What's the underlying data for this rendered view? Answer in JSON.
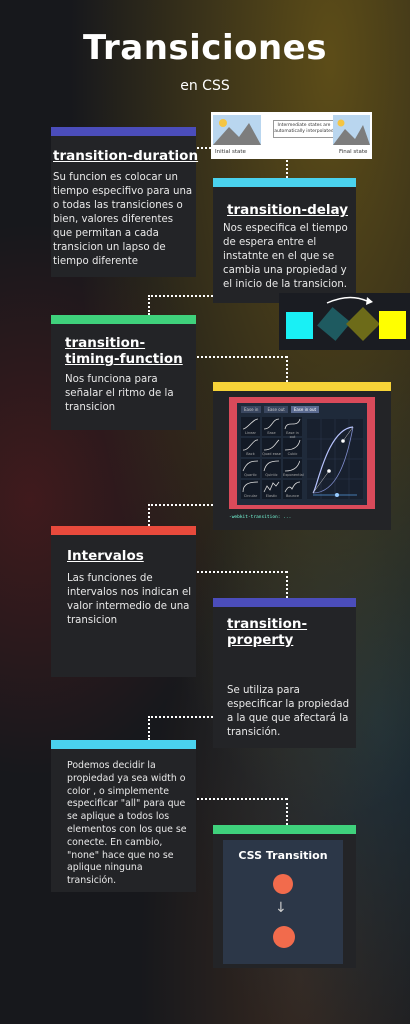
{
  "header": {
    "title": "Transiciones",
    "subtitle": "en CSS"
  },
  "cards": [
    {
      "title": "transition-duration",
      "body": "Su funcion es colocar un tiempo especifivo para una o todas las transiciones o bien, valores diferentes que permitan a cada transicion un lapso de tiempo diferente",
      "color": "#4b4dbb"
    },
    {
      "title": "transition-delay",
      "body": "Nos especifica el tiempo de espera entre el instatnte en el que se cambia una propiedad y el inicio de la transicion.",
      "color": "#4ad2ee"
    },
    {
      "title": "transition-timing-function",
      "body": "Nos funciona para señalar el ritmo de la transicion",
      "color": "#3fd17c"
    },
    {
      "title": "Intervalos",
      "body": "Las funciones de intervalos nos indican el valor intermedio de una transicion",
      "color": "#e84a3c"
    },
    {
      "title": "transition-property",
      "body": "Se utiliza para especificar la propiedad a la que que afectará la transición.",
      "color": "#4b4dbb"
    },
    {
      "title": "",
      "body": "Podemos decidir la propiedad ya sea width o color , o simplemente especificar \"all\" para que se aplique a todos los elementos con los que se conecte. En cambio, \"none\" hace que no se aplique ninguna transición.",
      "color": "#4ad2ee"
    },
    {
      "title": "",
      "body": "",
      "color": "#3fd17c"
    },
    {
      "title": "",
      "body": "",
      "color": "#f7d338"
    }
  ],
  "duration_image": {
    "initial_label": "Initial state",
    "final_label": "Final state",
    "middle_text": "Intermediate states are automatically interpolated"
  },
  "timing_image": {
    "tabs": [
      "Ease in",
      "Ease out",
      "Ease in out"
    ],
    "curves": [
      "Linear",
      "Ease",
      "Ease in out",
      "Back",
      "Quad ease",
      "Cubic",
      "Quartic",
      "Quintic",
      "Exponential",
      "Circular",
      "Elastic",
      "Bounce"
    ],
    "footer": "-webkit-transition: ..."
  },
  "css_transition_image": {
    "title": "CSS Transition"
  },
  "colors": {
    "swatch1": "#19f0f5",
    "swatch2": "#1e5a60",
    "swatch3": "#6d6b19",
    "swatch4": "#ffff00",
    "ball": "#f26b4c"
  }
}
